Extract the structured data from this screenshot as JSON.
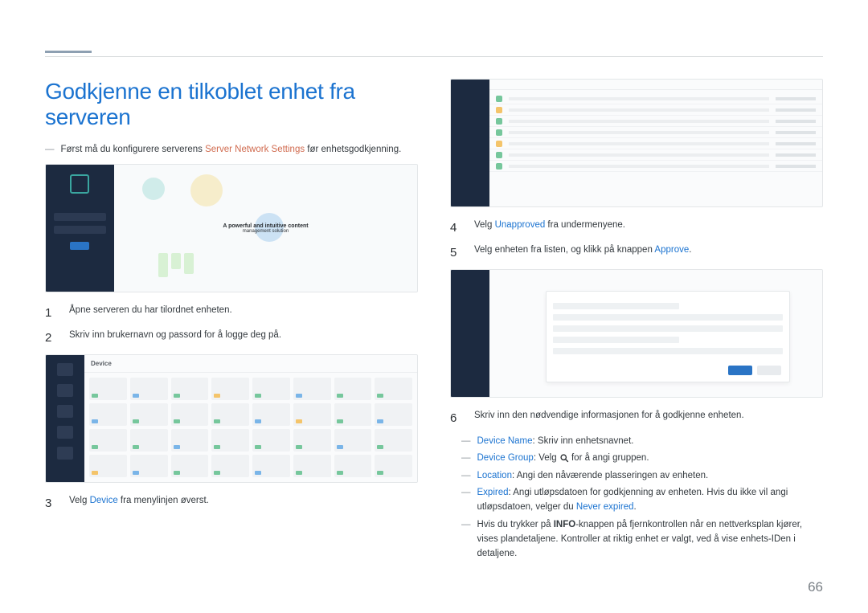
{
  "page": {
    "title": "Godkjenne en tilkoblet enhet fra serveren",
    "number": "66"
  },
  "intro": {
    "pre": "Først må du konfigurere serverens ",
    "link": "Server Network Settings",
    "post": " før enhetsgodkjenning."
  },
  "steps_left": {
    "s1": {
      "num": "1",
      "text": "Åpne serveren du har tilordnet enheten."
    },
    "s2": {
      "num": "2",
      "text": "Skriv inn brukernavn og passord for å logge deg på."
    },
    "s3": {
      "num": "3",
      "pre": "Velg ",
      "link": "Device",
      "post": " fra menylinjen øverst."
    }
  },
  "steps_right": {
    "s4": {
      "num": "4",
      "pre": "Velg ",
      "link": "Unapproved",
      "post": " fra undermenyene."
    },
    "s5": {
      "num": "5",
      "pre": "Velg enheten fra listen, og klikk på knappen ",
      "link": "Approve",
      "post": "."
    },
    "s6": {
      "num": "6",
      "text": "Skriv inn den nødvendige informasjonen for å godkjenne enheten."
    }
  },
  "sublist": {
    "a": {
      "label": "Device Name",
      "text": ": Skriv inn enhetsnavnet."
    },
    "b": {
      "label": "Device Group",
      "pre": ": Velg ",
      "post": " for å angi gruppen."
    },
    "c": {
      "label": "Location",
      "text": ": Angi den nåværende plasseringen av enheten."
    },
    "d": {
      "label": "Expired",
      "pre": ": Angi utløpsdatoen for godkjenning av enheten. Hvis du ikke vil angi utløpsdatoen, velger du ",
      "link": "Never expired",
      "post": "."
    },
    "e": {
      "pre": "Hvis du trykker på ",
      "bold": "INFO",
      "post": "-knappen på fjernkontrollen når en nettverksplan kjører, vises plandetaljene. Kontroller at riktig enhet er valgt, ved å vise enhets-IDen i detaljene."
    }
  },
  "ss_login": {
    "headline": "A powerful and intuitive content",
    "sub": "management solution"
  },
  "ss_grid": {
    "title": "Device"
  }
}
